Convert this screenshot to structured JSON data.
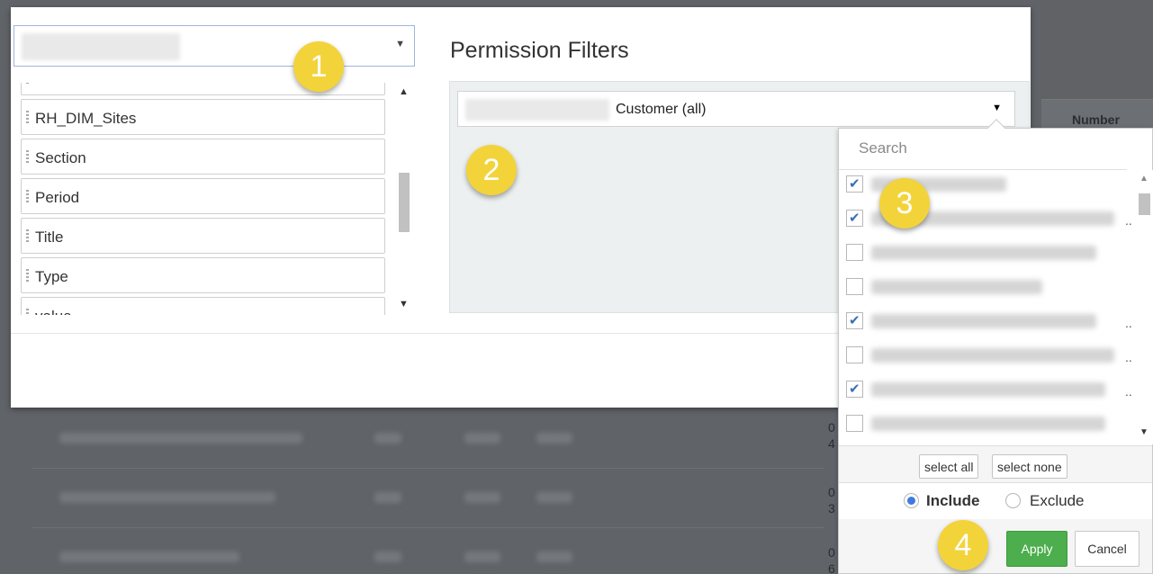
{
  "background": {
    "table_header": "Number",
    "row_numbers": [
      "0\n4",
      "0\n3",
      "0\n6"
    ]
  },
  "field_select": {
    "value": ""
  },
  "field_list": {
    "items": [
      "RH_DIM_Sites",
      "Section",
      "Period",
      "Title",
      "Type",
      "value"
    ]
  },
  "permission": {
    "title": "Permission Filters",
    "filter_value": "Customer (all)"
  },
  "dropdown": {
    "search_placeholder": "Search",
    "items": [
      {
        "checked": true,
        "overflow": false
      },
      {
        "checked": true,
        "overflow": true
      },
      {
        "checked": false,
        "overflow": false
      },
      {
        "checked": false,
        "overflow": false
      },
      {
        "checked": true,
        "overflow": true
      },
      {
        "checked": false,
        "overflow": true
      },
      {
        "checked": true,
        "overflow": true
      },
      {
        "checked": false,
        "overflow": false
      }
    ],
    "select_all_label": "select all",
    "select_none_label": "select none",
    "mode": {
      "include_label": "Include",
      "exclude_label": "Exclude",
      "selected": "include"
    },
    "apply_label": "Apply",
    "cancel_label": "Cancel"
  },
  "callouts": [
    "1",
    "2",
    "3",
    "4"
  ],
  "colors": {
    "accent_green": "#4cae4c",
    "callout_yellow": "#f3d33a",
    "radio_blue": "#3d7be0",
    "checkbox_blue": "#3a6fb5"
  }
}
